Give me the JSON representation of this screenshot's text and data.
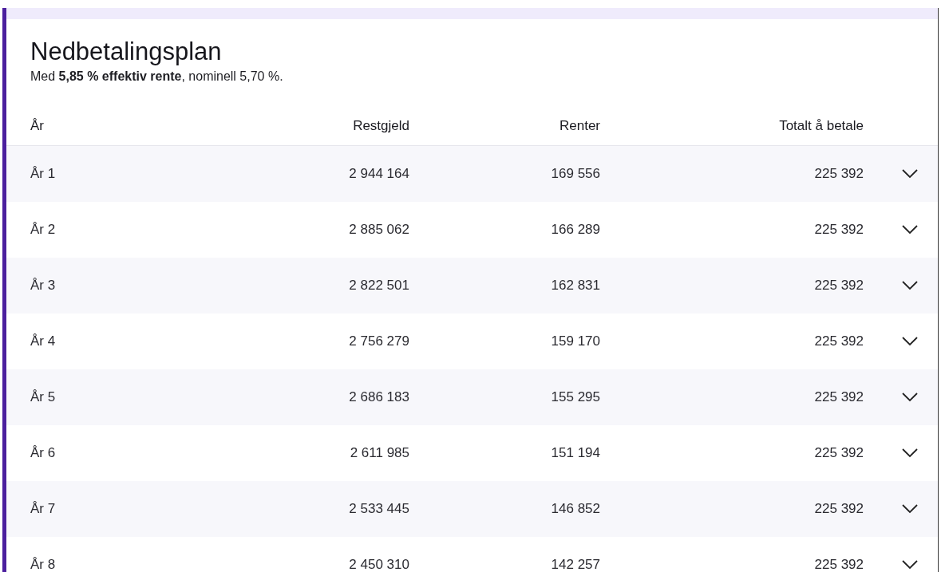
{
  "title": "Nedbetalingsplan",
  "subtitle": "Med **5,85 % effektiv rente**, nominell 5,70 %.",
  "table": {
    "columns": [
      "År",
      "Restgjeld",
      "Renter",
      "Totalt å betale"
    ],
    "rows": [
      {
        "cells": [
          "År 1",
          "2 944 164",
          "169 556",
          "225 392"
        ],
        "expanded": false
      },
      {
        "cells": [
          "År 2",
          "2 885 062",
          "166 289",
          "225 392"
        ],
        "expanded": false
      },
      {
        "cells": [
          "År 3",
          "2 822 501",
          "162 831",
          "225 392"
        ],
        "expanded": false
      },
      {
        "cells": [
          "År 4",
          "2 756 279",
          "159 170",
          "225 392"
        ],
        "expanded": false
      },
      {
        "cells": [
          "År 5",
          "2 686 183",
          "155 295",
          "225 392"
        ],
        "expanded": false
      },
      {
        "cells": [
          "År 6",
          "2 611 985",
          "151 194",
          "225 392"
        ],
        "expanded": false
      },
      {
        "cells": [
          "År 7",
          "2 533 445",
          "146 852",
          "225 392"
        ],
        "expanded": false
      },
      {
        "cells": [
          "År 8",
          "2 450 310",
          "142 257",
          "225 392"
        ],
        "expanded": false
      }
    ]
  }
}
